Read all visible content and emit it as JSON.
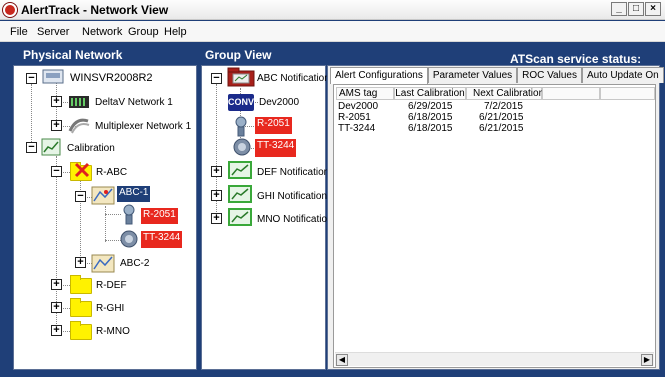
{
  "window": {
    "title": "AlertTrack - Network View"
  },
  "menu": [
    "File",
    "Server",
    "Network",
    "Group",
    "Help"
  ],
  "headers": {
    "physical": "Physical Network",
    "group": "Group View",
    "status": "ATScan service status: Running"
  },
  "physical_tree": {
    "server": "WINSVR2008R2",
    "deltav": "DeltaV Network 1",
    "multiplexer": "Multiplexer Network 1",
    "calibration": "Calibration",
    "rabc": "R-ABC",
    "abc1": "ABC-1",
    "r2051": "R-2051",
    "tt3244": "TT-3244",
    "abc2": "ABC-2",
    "rdef": "R-DEF",
    "rghi": "R-GHI",
    "rmno": "R-MNO"
  },
  "group_tree": {
    "abc": "ABC Notification",
    "conv_badge": "CONV",
    "dev2000": "Dev2000",
    "r2051": "R-2051",
    "tt3244": "TT-3244",
    "def": "DEF Notification",
    "ghi": "GHI Notification",
    "mno": "MNO Notification"
  },
  "tabs": [
    "Alert Configurations",
    "Parameter Values",
    "ROC Values",
    "Auto Update On"
  ],
  "table": {
    "columns": [
      "AMS tag",
      "Last Calibration",
      "Next Calibration"
    ],
    "rows": [
      [
        "Dev2000",
        "6/29/2015",
        "7/2/2015"
      ],
      [
        "R-2051",
        "6/18/2015",
        "6/21/2015"
      ],
      [
        "TT-3244",
        "6/18/2015",
        "6/21/2015"
      ]
    ]
  },
  "glyphs": {
    "minimize": "_",
    "maximize": "□",
    "close": "×",
    "plus": "+",
    "minus": "−",
    "left": "◀",
    "right": "▶"
  }
}
